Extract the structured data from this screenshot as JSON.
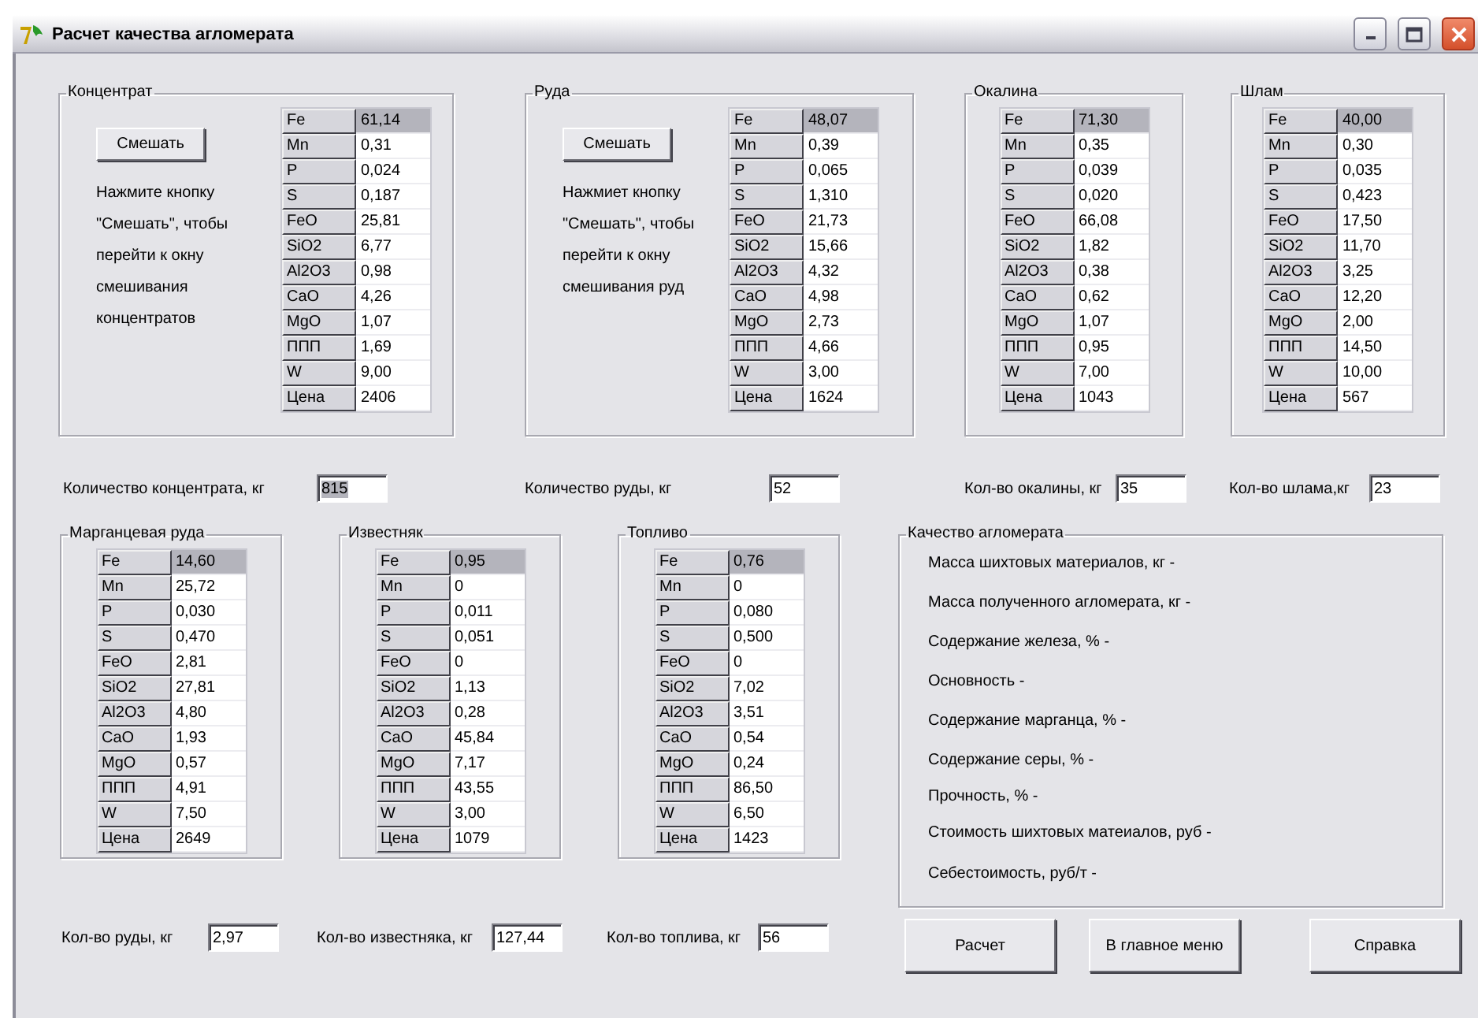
{
  "window": {
    "title": "Расчет качества агломерата"
  },
  "groups": [
    {
      "title": "Концентрат",
      "button": "Смешать",
      "hint": "Нажмите кнопку\n\"Смешать\", чтобы\nперейти к окну\nсмешивания\nконцентратов",
      "rows": [
        {
          "label": "Fe",
          "value": "61,14",
          "selected": true
        },
        {
          "label": "Mn",
          "value": "0,31",
          "selected": false
        },
        {
          "label": "P",
          "value": "0,024",
          "selected": false
        },
        {
          "label": "S",
          "value": "0,187",
          "selected": false
        },
        {
          "label": "FeO",
          "value": "25,81",
          "selected": false
        },
        {
          "label": "SiO2",
          "value": "6,77",
          "selected": false
        },
        {
          "label": "Al2O3",
          "value": "0,98",
          "selected": false
        },
        {
          "label": "CaO",
          "value": "4,26",
          "selected": false
        },
        {
          "label": "MgO",
          "value": "1,07",
          "selected": false
        },
        {
          "label": "ППП",
          "value": "1,69",
          "selected": false
        },
        {
          "label": "W",
          "value": "9,00",
          "selected": false
        },
        {
          "label": "Цена",
          "value": "2406",
          "selected": false
        }
      ]
    },
    {
      "title": "Руда",
      "button": "Смешать",
      "hint": "Нажмиет кнопку\n\"Смешать\", чтобы\nперейти к окну\nсмешивания руд",
      "rows": [
        {
          "label": "Fe",
          "value": "48,07",
          "selected": true
        },
        {
          "label": "Mn",
          "value": "0,39",
          "selected": false
        },
        {
          "label": "P",
          "value": "0,065",
          "selected": false
        },
        {
          "label": "S",
          "value": "1,310",
          "selected": false
        },
        {
          "label": "FeO",
          "value": "21,73",
          "selected": false
        },
        {
          "label": "SiO2",
          "value": "15,66",
          "selected": false
        },
        {
          "label": "Al2O3",
          "value": "4,32",
          "selected": false
        },
        {
          "label": "CaO",
          "value": "4,98",
          "selected": false
        },
        {
          "label": "MgO",
          "value": "2,73",
          "selected": false
        },
        {
          "label": "ППП",
          "value": "4,66",
          "selected": false
        },
        {
          "label": "W",
          "value": "3,00",
          "selected": false
        },
        {
          "label": "Цена",
          "value": "1624",
          "selected": false
        }
      ]
    },
    {
      "title": "Окалина",
      "rows": [
        {
          "label": "Fe",
          "value": "71,30",
          "selected": true
        },
        {
          "label": "Mn",
          "value": "0,35",
          "selected": false
        },
        {
          "label": "P",
          "value": "0,039",
          "selected": false
        },
        {
          "label": "S",
          "value": "0,020",
          "selected": false
        },
        {
          "label": "FeO",
          "value": "66,08",
          "selected": false
        },
        {
          "label": "SiO2",
          "value": "1,82",
          "selected": false
        },
        {
          "label": "Al2O3",
          "value": "0,38",
          "selected": false
        },
        {
          "label": "CaO",
          "value": "0,62",
          "selected": false
        },
        {
          "label": "MgO",
          "value": "1,07",
          "selected": false
        },
        {
          "label": "ППП",
          "value": "0,95",
          "selected": false
        },
        {
          "label": "W",
          "value": "7,00",
          "selected": false
        },
        {
          "label": "Цена",
          "value": "1043",
          "selected": false
        }
      ]
    },
    {
      "title": "Шлам",
      "rows": [
        {
          "label": "Fe",
          "value": "40,00",
          "selected": true
        },
        {
          "label": "Mn",
          "value": "0,30",
          "selected": false
        },
        {
          "label": "P",
          "value": "0,035",
          "selected": false
        },
        {
          "label": "S",
          "value": "0,423",
          "selected": false
        },
        {
          "label": "FeO",
          "value": "17,50",
          "selected": false
        },
        {
          "label": "SiO2",
          "value": "11,70",
          "selected": false
        },
        {
          "label": "Al2O3",
          "value": "3,25",
          "selected": false
        },
        {
          "label": "CaO",
          "value": "12,20",
          "selected": false
        },
        {
          "label": "MgO",
          "value": "2,00",
          "selected": false
        },
        {
          "label": "ППП",
          "value": "14,50",
          "selected": false
        },
        {
          "label": "W",
          "value": "10,00",
          "selected": false
        },
        {
          "label": "Цена",
          "value": "567",
          "selected": false
        }
      ]
    }
  ],
  "quantities": [
    {
      "label": "Количество концентрата, кг",
      "value": "815",
      "selected": true
    },
    {
      "label": "Количество руды, кг",
      "value": "52",
      "selected": false
    },
    {
      "label": "Кол-во окалины, кг",
      "value": "35",
      "selected": false
    },
    {
      "label": "Кол-во шлама,кг",
      "value": "23",
      "selected": false
    }
  ],
  "lower_groups": [
    {
      "title": "Марганцевая руда",
      "rows": [
        {
          "label": "Fe",
          "value": "14,60",
          "selected": true
        },
        {
          "label": "Mn",
          "value": "25,72",
          "selected": false
        },
        {
          "label": "P",
          "value": "0,030",
          "selected": false
        },
        {
          "label": "S",
          "value": "0,470",
          "selected": false
        },
        {
          "label": "FeO",
          "value": "2,81",
          "selected": false
        },
        {
          "label": "SiO2",
          "value": "27,81",
          "selected": false
        },
        {
          "label": "Al2O3",
          "value": "4,80",
          "selected": false
        },
        {
          "label": "CaO",
          "value": "1,93",
          "selected": false
        },
        {
          "label": "MgO",
          "value": "0,57",
          "selected": false
        },
        {
          "label": "ППП",
          "value": "4,91",
          "selected": false
        },
        {
          "label": "W",
          "value": "7,50",
          "selected": false
        },
        {
          "label": "Цена",
          "value": "2649",
          "selected": false
        }
      ]
    },
    {
      "title": "Известняк",
      "rows": [
        {
          "label": "Fe",
          "value": "0,95",
          "selected": true
        },
        {
          "label": "Mn",
          "value": "0",
          "selected": false
        },
        {
          "label": "P",
          "value": "0,011",
          "selected": false
        },
        {
          "label": "S",
          "value": "0,051",
          "selected": false
        },
        {
          "label": "FeO",
          "value": "0",
          "selected": false
        },
        {
          "label": "SiO2",
          "value": "1,13",
          "selected": false
        },
        {
          "label": "Al2O3",
          "value": "0,28",
          "selected": false
        },
        {
          "label": "CaO",
          "value": "45,84",
          "selected": false
        },
        {
          "label": "MgO",
          "value": "7,17",
          "selected": false
        },
        {
          "label": "ППП",
          "value": "43,55",
          "selected": false
        },
        {
          "label": "W",
          "value": "3,00",
          "selected": false
        },
        {
          "label": "Цена",
          "value": "1079",
          "selected": false
        }
      ]
    },
    {
      "title": "Топливо",
      "rows": [
        {
          "label": "Fe",
          "value": "0,76",
          "selected": true
        },
        {
          "label": "Mn",
          "value": "0",
          "selected": false
        },
        {
          "label": "P",
          "value": "0,080",
          "selected": false
        },
        {
          "label": "S",
          "value": "0,500",
          "selected": false
        },
        {
          "label": "FeO",
          "value": "0",
          "selected": false
        },
        {
          "label": "SiO2",
          "value": "7,02",
          "selected": false
        },
        {
          "label": "Al2O3",
          "value": "3,51",
          "selected": false
        },
        {
          "label": "CaO",
          "value": "0,54",
          "selected": false
        },
        {
          "label": "MgO",
          "value": "0,24",
          "selected": false
        },
        {
          "label": "ППП",
          "value": "86,50",
          "selected": false
        },
        {
          "label": "W",
          "value": "6,50",
          "selected": false
        },
        {
          "label": "Цена",
          "value": "1423",
          "selected": false
        }
      ]
    }
  ],
  "lower_quantities": [
    {
      "label": "Кол-во руды, кг",
      "value": "2,97",
      "selected": false
    },
    {
      "label": "Кол-во известняка, кг",
      "value": "127,44",
      "selected": false
    },
    {
      "label": "Кол-во топлива, кг",
      "value": "56",
      "selected": false
    }
  ],
  "quality": {
    "title": "Качество агломерата",
    "items": [
      "Масса шихтовых материалов, кг -",
      "Масса полученного агломерата, кг -",
      "Содержание железа, % -",
      "Основность -",
      "Содержание марганца, % -",
      "Содержание серы, % -",
      "Прочность, % -",
      "Стоимость шихтовых матеиалов, руб -",
      "Себестоимость, руб/т -"
    ]
  },
  "buttons": [
    "Расчет",
    "В главное меню",
    "Справка"
  ]
}
